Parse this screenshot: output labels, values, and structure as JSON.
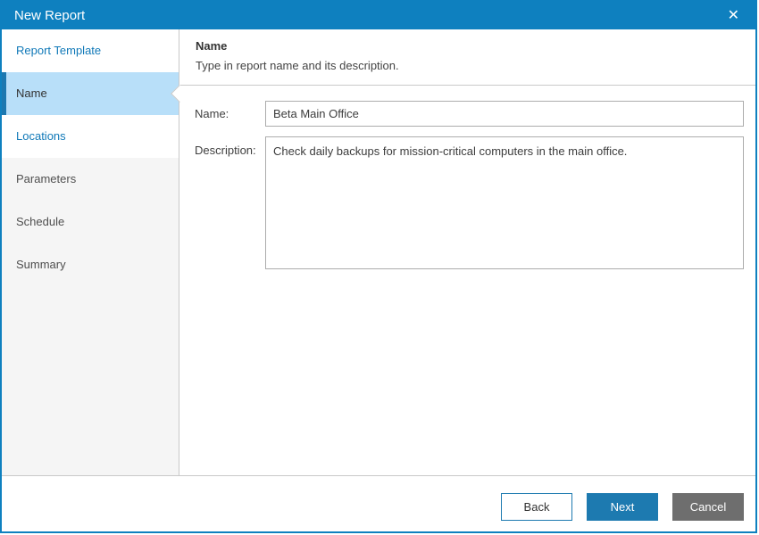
{
  "window": {
    "title": "New Report",
    "close_icon": "✕"
  },
  "colors": {
    "titlebar_blue": "#0e80bf",
    "accent_blue": "#1d7ab0",
    "active_step_highlight": "#b8dff9",
    "active_step_stripe": "#1d78b0",
    "step_link_text": "#1179b8",
    "disabled_step_bg": "#f5f5f5",
    "cancel_gray": "#6e6e6e",
    "separator_gray": "#c9c9c9"
  },
  "sidebar": {
    "items": [
      {
        "label": "Report Template",
        "state": "link"
      },
      {
        "label": "Name",
        "state": "active"
      },
      {
        "label": "Locations",
        "state": "link"
      },
      {
        "label": "Parameters",
        "state": "disabled"
      },
      {
        "label": "Schedule",
        "state": "disabled"
      },
      {
        "label": "Summary",
        "state": "disabled"
      }
    ]
  },
  "header": {
    "title": "Name",
    "subtitle": "Type in report name and its description."
  },
  "form": {
    "name_label": "Name:",
    "name_value": "Beta Main Office",
    "description_label": "Description:",
    "description_value": "Check daily backups for mission-critical computers in the main office."
  },
  "footer": {
    "back_label": "Back",
    "next_label": "Next",
    "cancel_label": "Cancel"
  }
}
